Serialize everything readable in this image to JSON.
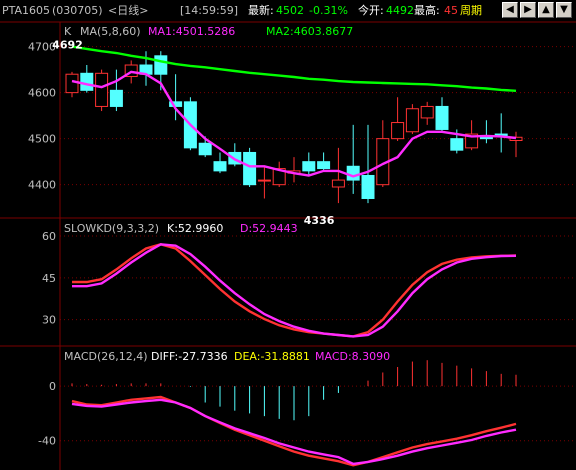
{
  "header": {
    "instrument": "PTA1605",
    "code": "(030705)",
    "period": "<日线>",
    "time": "[14:59:59]",
    "latest_label": "最新:",
    "latest_value": "4502",
    "change_pct": "-0.31%",
    "open_label": "今开:",
    "open_value": "4492",
    "high_label": "最高:",
    "high_value": "45",
    "cycle_button": "周期",
    "nav_icons": [
      "arrow-left-icon",
      "arrow-right-icon",
      "arrow-up-icon",
      "arrow-down-icon"
    ]
  },
  "colors": {
    "up": "#ff3232",
    "down": "#54ffff",
    "ma1": "#ff2bff",
    "ma2": "#00ff00",
    "grid": "#7a0000",
    "axis_text": "#c0c0c0",
    "header_red": "#ff3232",
    "header_green": "#00ff00",
    "header_yellow": "#ffff00"
  },
  "chart_data": [
    {
      "type": "candlestick",
      "panel": "main",
      "title": "K",
      "indicator_label": "MA(5,8,60)",
      "ma1_text": "MA1:4501.5286",
      "ma2_text": "MA2:4603.8677",
      "ylim": [
        4345,
        4710
      ],
      "yticks": [
        4700,
        4600,
        4500,
        4400
      ],
      "candles": [
        [
          4600,
          4640,
          4645,
          4590
        ],
        [
          4642,
          4605,
          4660,
          4600
        ],
        [
          4570,
          4642,
          4650,
          4560
        ],
        [
          4605,
          4570,
          4650,
          4560
        ],
        [
          4635,
          4660,
          4670,
          4620
        ],
        [
          4660,
          4640,
          4690,
          4615
        ],
        [
          4680,
          4640,
          4690,
          4605
        ],
        [
          4580,
          4570,
          4640,
          4540
        ],
        [
          4580,
          4480,
          4590,
          4475
        ],
        [
          4490,
          4465,
          4505,
          4460
        ],
        [
          4450,
          4430,
          4470,
          4425
        ],
        [
          4470,
          4445,
          4490,
          4440
        ],
        [
          4470,
          4400,
          4480,
          4395
        ],
        [
          4410,
          4410,
          4440,
          4370
        ],
        [
          4400,
          4435,
          4450,
          4395
        ],
        [
          4425,
          4430,
          4460,
          4405
        ],
        [
          4450,
          4430,
          4470,
          4420
        ],
        [
          4450,
          4435,
          4470,
          4430
        ],
        [
          4395,
          4410,
          4480,
          4360
        ],
        [
          4440,
          4410,
          4530,
          4380
        ],
        [
          4420,
          4370,
          4530,
          4360
        ],
        [
          4400,
          4500,
          4540,
          4395
        ],
        [
          4500,
          4535,
          4590,
          4495
        ],
        [
          4515,
          4565,
          4575,
          4510
        ],
        [
          4545,
          4570,
          4580,
          4530
        ],
        [
          4570,
          4520,
          4590,
          4515
        ],
        [
          4500,
          4475,
          4520,
          4468
        ],
        [
          4480,
          4510,
          4540,
          4475
        ],
        [
          4505,
          4500,
          4540,
          4490
        ],
        [
          4510,
          4505,
          4555,
          4470
        ],
        [
          4496,
          4503,
          4515,
          4460
        ]
      ],
      "ma1": [
        4625,
        4618,
        4612,
        4625,
        4645,
        4640,
        4620,
        4565,
        4530,
        4500,
        4478,
        4455,
        4440,
        4440,
        4432,
        4425,
        4420,
        4430,
        4430,
        4418,
        4428,
        4445,
        4460,
        4500,
        4515,
        4515,
        4510,
        4505,
        4506,
        4505,
        4501.5
      ],
      "ma2": [
        4700,
        4695,
        4690,
        4686,
        4680,
        4675,
        4668,
        4662,
        4658,
        4655,
        4651,
        4647,
        4643,
        4640,
        4637,
        4634,
        4630,
        4628,
        4625,
        4623,
        4622,
        4621,
        4620,
        4619,
        4618,
        4616,
        4614,
        4611,
        4609,
        4606,
        4603.9
      ],
      "annotations": [
        {
          "label": "4692",
          "at_candle": 1,
          "price": 4692
        },
        {
          "label": "4336",
          "at_candle": 18,
          "price": 4336
        }
      ]
    },
    {
      "type": "line",
      "panel": "slowkd",
      "title": "SLOWKD(9,3,3,2)",
      "k_text": "K:52.9960",
      "d_text": "D:52.9443",
      "ylim": [
        22,
        65
      ],
      "yticks": [
        60,
        45,
        30
      ],
      "series": [
        {
          "name": "K",
          "values": [
            43.5,
            43.5,
            44.5,
            48,
            52,
            55.5,
            57,
            55.5,
            51,
            46,
            41,
            36.5,
            33,
            30.2,
            28,
            26.5,
            25.5,
            25,
            24.5,
            24,
            25.5,
            30,
            36.5,
            42.5,
            47,
            50,
            51.5,
            52.3,
            52.7,
            52.9,
            53
          ]
        },
        {
          "name": "D",
          "values": [
            42,
            42,
            43,
            46.5,
            50.5,
            54,
            57,
            56.5,
            53.5,
            49,
            44,
            39.5,
            35.5,
            32,
            29.5,
            27.5,
            26,
            25,
            24.5,
            24,
            24.5,
            27.5,
            33,
            39.5,
            44.5,
            48,
            50.5,
            51.8,
            52.4,
            52.8,
            52.9
          ]
        }
      ]
    },
    {
      "type": "line",
      "panel": "macd",
      "title": "MACD(26,12,4)",
      "diff_text": "DIFF:-27.7336",
      "dea_text": "DEA:-31.8881",
      "macd_text": "MACD:8.3090",
      "ylim": [
        -60,
        25
      ],
      "yticks": [
        0,
        -40
      ],
      "series": [
        {
          "name": "DIFF",
          "values": [
            -11,
            -13.5,
            -14,
            -12,
            -10,
            -9,
            -8,
            -12,
            -16,
            -22,
            -27,
            -32,
            -36,
            -40,
            -44,
            -48,
            -51,
            -53,
            -55,
            -58,
            -55.5,
            -52,
            -48.5,
            -45,
            -42.5,
            -40.5,
            -38.5,
            -36,
            -33,
            -30.5,
            -27.7
          ]
        },
        {
          "name": "DEA",
          "values": [
            -13,
            -14.5,
            -15,
            -13.5,
            -12,
            -11,
            -10,
            -12,
            -16,
            -22,
            -26.5,
            -31,
            -34.5,
            -38,
            -42,
            -45,
            -48,
            -50,
            -52,
            -57,
            -55.5,
            -53.5,
            -51,
            -48,
            -45.5,
            -43.5,
            -41.5,
            -39.5,
            -36.5,
            -34,
            -31.9
          ]
        }
      ],
      "histogram": [
        2,
        1.5,
        1,
        1.5,
        2,
        2,
        2,
        0,
        -0.5,
        -12,
        -15,
        -18,
        -20,
        -22,
        -24,
        -25,
        -22,
        -10,
        -5,
        0,
        4,
        10,
        14,
        18,
        19,
        17,
        15,
        13,
        11,
        9,
        8.3
      ]
    }
  ]
}
